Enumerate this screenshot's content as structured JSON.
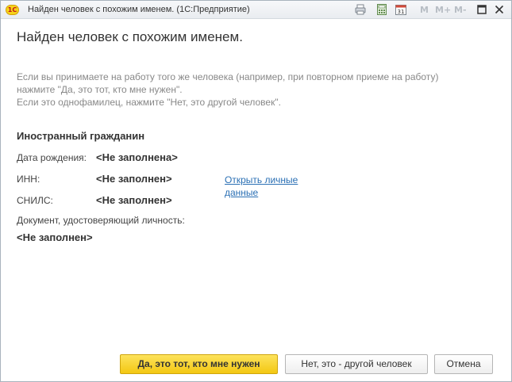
{
  "window": {
    "title": "Найден человек с похожим именем.  (1С:Предприятие)",
    "logo_text": "1С",
    "toolbar": {
      "m_label": "M",
      "m_plus_label": "M+",
      "m_minus_label": "M-",
      "calendar_day": "31"
    }
  },
  "dialog": {
    "heading": "Найден человек с похожим именем.",
    "description_lines": [
      "Если вы принимаете на работу того же человека (например, при повторном приеме на работу)",
      "нажмите \"Да, это тот, кто мне нужен\".",
      "Если это однофамилец, нажмите \"Нет, это другой человек\"."
    ],
    "person": {
      "name": "Иностранный гражданин",
      "birth_date_label": "Дата рождения:",
      "birth_date_value": "<Не заполнена>",
      "inn_label": "ИНН:",
      "inn_value": "<Не заполнен>",
      "snils_label": "СНИЛС:",
      "snils_value": "<Не заполнен>",
      "document_label": "Документ, удостоверяющий личность:",
      "document_value": "<Не заполнен>",
      "open_link_line1": "Открыть личные",
      "open_link_line2": "данные"
    },
    "buttons": {
      "yes": "Да, это тот, кто мне нужен",
      "no": "Нет, это - другой человек",
      "cancel": "Отмена"
    }
  },
  "colors": {
    "primary_button": "#f3c712",
    "link": "#2a6fb4",
    "description_text": "#888888"
  }
}
